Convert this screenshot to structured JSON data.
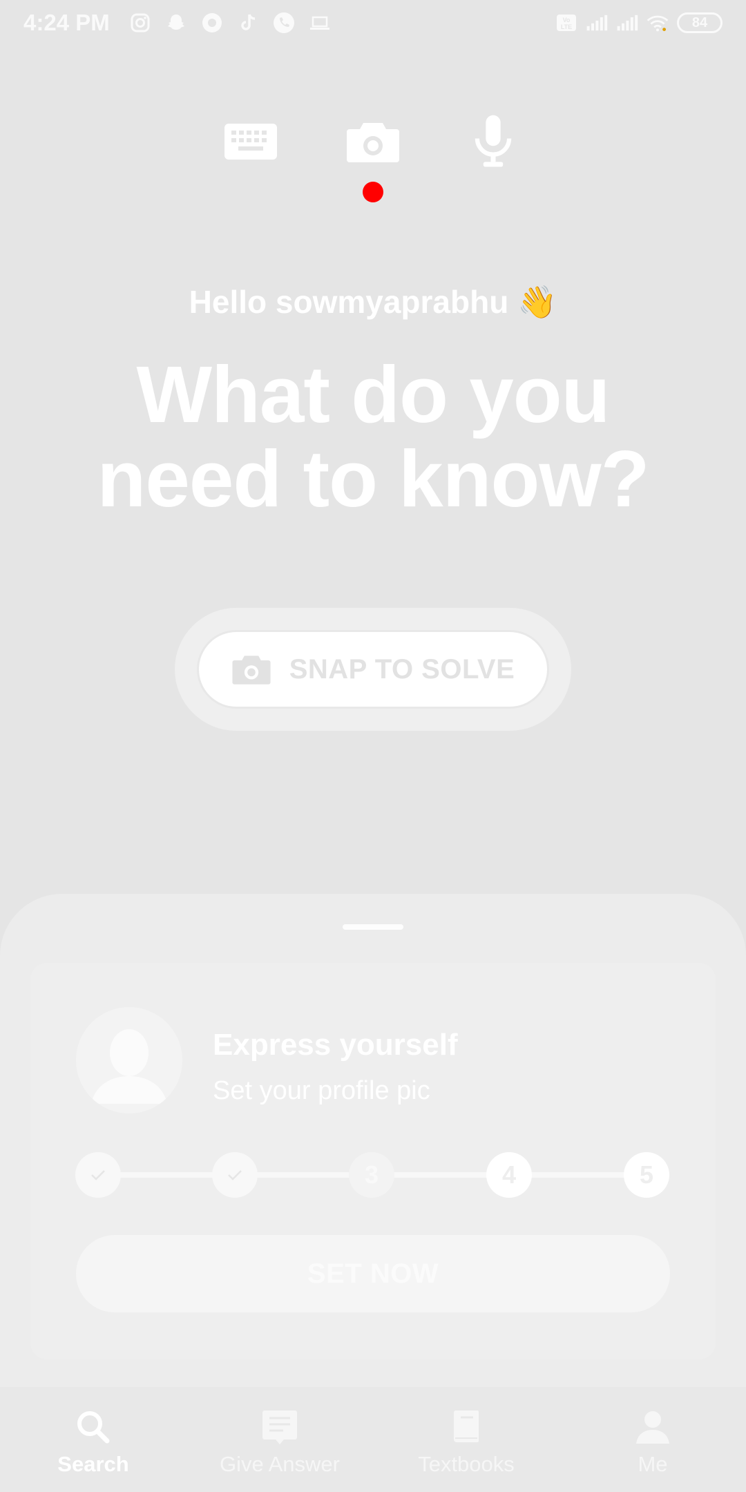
{
  "status_bar": {
    "time": "4:24 PM",
    "notification_icons": [
      "instagram-icon",
      "snapchat-icon",
      "circle-app-icon",
      "tiktok-icon",
      "phone-call-icon",
      "laptop-icon"
    ],
    "network_badge": "Vo LTE",
    "battery_level": "84"
  },
  "mode_switcher": {
    "modes": [
      "keyboard-icon",
      "camera-icon",
      "microphone-icon"
    ],
    "active_mode": "camera",
    "indicator_color": "#ff0000"
  },
  "greeting": {
    "text": "Hello sowmyaprabhu",
    "emoji": "👋"
  },
  "headline": {
    "line1": "What do you",
    "line2": "need to know?"
  },
  "snap_button": {
    "label": "SNAP TO SOLVE"
  },
  "onboarding_card": {
    "title": "Express yourself",
    "subtitle": "Set your profile pic",
    "steps": [
      {
        "label": "",
        "status": "done"
      },
      {
        "label": "",
        "status": "done"
      },
      {
        "label": "3",
        "status": "current"
      },
      {
        "label": "4",
        "status": "todo"
      },
      {
        "label": "5",
        "status": "todo"
      }
    ],
    "cta_label": "SET NOW"
  },
  "bottom_nav": {
    "items": [
      {
        "label": "Search",
        "icon": "search-icon",
        "active": true
      },
      {
        "label": "Give Answer",
        "icon": "answer-icon",
        "active": false
      },
      {
        "label": "Textbooks",
        "icon": "book-icon",
        "active": false
      },
      {
        "label": "Me",
        "icon": "person-icon",
        "active": false
      }
    ]
  },
  "colors": {
    "background": "#e5e5e5",
    "accent_red": "#ff0000",
    "text": "#ffffff"
  }
}
